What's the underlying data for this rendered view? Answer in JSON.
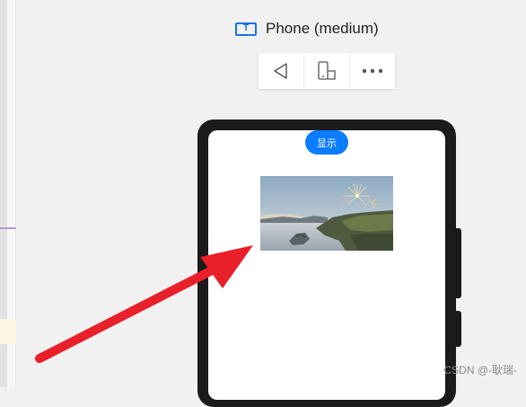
{
  "previewer": {
    "device_name": "Phone (medium)",
    "device_icon_letter": "T"
  },
  "toolbar": {
    "icons": [
      "back-icon",
      "rotate-device-icon",
      "more-icon"
    ]
  },
  "app": {
    "show_button_label": "显示"
  },
  "colors": {
    "accent_blue": "#0a7cff",
    "arrow_red": "#e8202a",
    "phone_frame": "#1b1b1b"
  },
  "watermark": "CSDN @-耿瑞-"
}
